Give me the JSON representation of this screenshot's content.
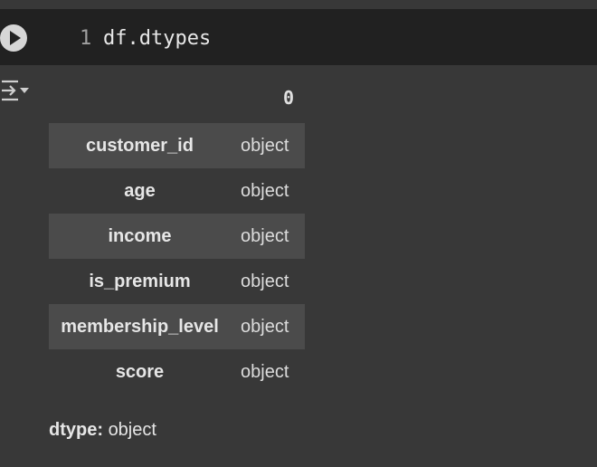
{
  "code_cell": {
    "line_number": "1",
    "code": "df.dtypes",
    "run_icon": "play-circle-icon"
  },
  "output": {
    "toggle_icon": "output-toggle-icon",
    "column_header": "0",
    "rows": [
      {
        "index": "customer_id",
        "value": "object"
      },
      {
        "index": "age",
        "value": "object"
      },
      {
        "index": "income",
        "value": "object"
      },
      {
        "index": "is_premium",
        "value": "object"
      },
      {
        "index": "membership_level",
        "value": "object"
      },
      {
        "index": "score",
        "value": "object"
      }
    ],
    "dtype_label": "dtype:",
    "dtype_value": "object"
  }
}
